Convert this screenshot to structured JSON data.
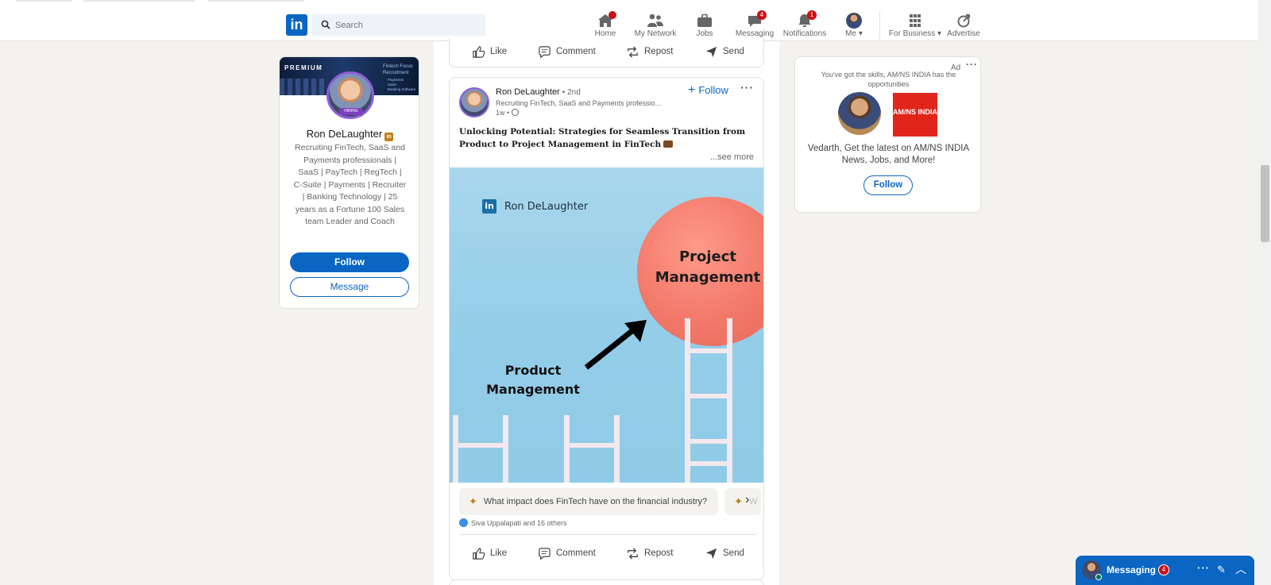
{
  "nav": {
    "search_placeholder": "Search",
    "items": [
      {
        "label": "Home",
        "icon": "home-icon",
        "badge": ""
      },
      {
        "label": "My Network",
        "icon": "network-icon",
        "badge": ""
      },
      {
        "label": "Jobs",
        "icon": "briefcase-icon",
        "badge": ""
      },
      {
        "label": "Messaging",
        "icon": "chat-icon",
        "badge": "4"
      },
      {
        "label": "Notifications",
        "icon": "bell-icon",
        "badge": "1"
      },
      {
        "label": "Me",
        "icon": "avatar"
      },
      {
        "label": "For Business",
        "icon": "grid-icon"
      },
      {
        "label": "Advertise",
        "icon": "advertise-icon"
      }
    ]
  },
  "profile": {
    "banner_label": "PREMIUM",
    "banner_title": "Fintech Focus Recruitment",
    "banner_bullets": [
      "Payments",
      "SaaS",
      "Banking Software"
    ],
    "badge": "HIRING",
    "name": "Ron DeLaughter",
    "description": "Recruiting FinTech, SaaS and Payments professionals | SaaS | PayTech | RegTech | C-Suite | Payments | Recruiter | Banking Technology | 25 years as a Fortune 100 Sales team Leader and Coach",
    "follow_label": "Follow",
    "message_label": "Message"
  },
  "actions": {
    "like": "Like",
    "comment": "Comment",
    "repost": "Repost",
    "send": "Send"
  },
  "post": {
    "author": "Ron DeLaughter",
    "degree": "• 2nd",
    "headline": "Recruiting FinTech, SaaS and Payments professio...",
    "time": "1w •",
    "follow_label": "Follow",
    "text": "Unlocking Potential: Strategies for Seamless Transition from Product to Project Management in FinTech",
    "see_more": "...see more",
    "image": {
      "brand": "Ron DeLaughter",
      "target_label": "Project Management",
      "source_label": "Product Management"
    },
    "prompts": [
      "What impact does FinTech have on the financial industry?",
      "W"
    ],
    "reactions": "Siva Uppalapati and 16 others"
  },
  "ad": {
    "label": "Ad",
    "tagline": "You've got the skills, AM/NS INDIA has the opportunities",
    "logo_text": "AM/NS INDIA",
    "text": "Vedarth, Get the latest on AM/NS INDIA News, Jobs, and More!",
    "follow_label": "Follow"
  },
  "messaging": {
    "title": "Messaging",
    "badge": "4"
  },
  "colors": {
    "brand": "#0a66c2",
    "notification": "#cc1016",
    "premium_gold": "#c37d16",
    "ball": "#f2786a",
    "image_bg": "#93cde8"
  }
}
